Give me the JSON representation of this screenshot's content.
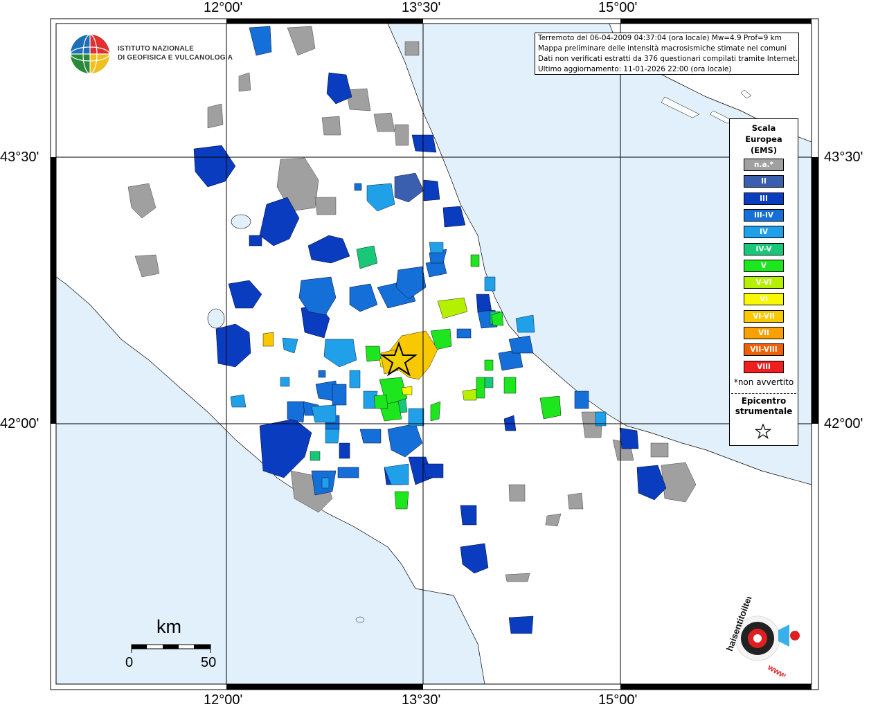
{
  "map": {
    "lon_labels": [
      "12°00'",
      "13°30'",
      "15°00'"
    ],
    "lat_labels": [
      "43°30'",
      "42°00'"
    ],
    "colors": {
      "sea": "#e1f0fb",
      "land": "#ffffff",
      "grid": "#000000"
    }
  },
  "info": {
    "line1": "Terremoto del 06-04-2009 04:37:04 (ora locale) Mw=4.9 Prof=9 km",
    "line2": "Mappa preliminare delle intensità macrosismiche stimate nei comuni",
    "line3": "Dati non verificati estratti da 376 questionari compilati tramite Internet.",
    "line4": "Ultimo aggiornamento: 11-01-2026 22:00 (ora locale)"
  },
  "legend": {
    "title1": "Scala",
    "title2": "Europea",
    "title3": "(EMS)",
    "items": [
      {
        "label": "n.a.*",
        "color": "#a0a0a0"
      },
      {
        "label": "II",
        "color": "#3a5faf"
      },
      {
        "label": "III",
        "color": "#0a3cc0"
      },
      {
        "label": "III-IV",
        "color": "#1470d8"
      },
      {
        "label": "IV",
        "color": "#20a0e8"
      },
      {
        "label": "IV-V",
        "color": "#18c878"
      },
      {
        "label": "V",
        "color": "#1ee61e"
      },
      {
        "label": "V-VI",
        "color": "#b4f000"
      },
      {
        "label": "VI",
        "color": "#f8f800"
      },
      {
        "label": "VI-VII",
        "color": "#f8c800"
      },
      {
        "label": "VII",
        "color": "#f8a000"
      },
      {
        "label": "VII-VIII",
        "color": "#f06000"
      },
      {
        "label": "VIII",
        "color": "#f01e1e"
      }
    ],
    "note": "*non avvertito",
    "epi1": "Epicentro",
    "epi2": "strumentale"
  },
  "logo": {
    "line1": "ISTITUTO NAZIONALE",
    "line2": "DI GEOFISICA E VULCANOLOGIA"
  },
  "scale": {
    "unit": "km",
    "min": "0",
    "max": "50"
  },
  "badge": {
    "text": "haisentitoilterremoto.it",
    "www": "www."
  }
}
